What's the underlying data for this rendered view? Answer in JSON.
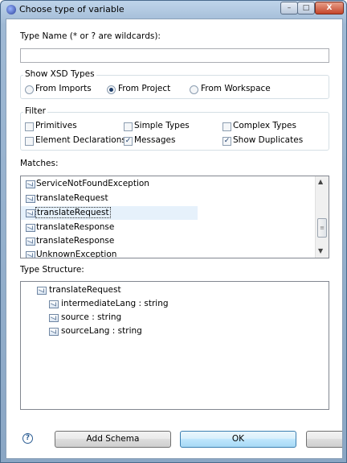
{
  "window": {
    "title": "Choose type of variable",
    "minimize": "–",
    "maximize": "□",
    "close": "X"
  },
  "type_name": {
    "label": "Type Name (* or ? are wildcards):",
    "value": ""
  },
  "xsd_group": {
    "title": "Show XSD Types",
    "options": [
      {
        "label": "From Imports",
        "selected": false
      },
      {
        "label": "From Project",
        "selected": true
      },
      {
        "label": "From Workspace",
        "selected": false
      }
    ]
  },
  "filter_group": {
    "title": "Filter",
    "items": [
      {
        "label": "Primitives",
        "checked": false
      },
      {
        "label": "Simple Types",
        "checked": false
      },
      {
        "label": "Complex Types",
        "checked": false
      },
      {
        "label": "Element Declarations",
        "checked": false
      },
      {
        "label": "Messages",
        "checked": true
      },
      {
        "label": "Show Duplicates",
        "checked": true
      }
    ]
  },
  "matches": {
    "label": "Matches:",
    "items": [
      {
        "label": "ServiceNotFoundException",
        "icon": "message-icon"
      },
      {
        "label": "translateRequest",
        "icon": "message-icon"
      },
      {
        "label": "translateRequest",
        "icon": "message-icon",
        "selected": true
      },
      {
        "label": "translateResponse",
        "icon": "message-icon"
      },
      {
        "label": "translateResponse",
        "icon": "message-icon"
      },
      {
        "label": "UnknownException",
        "icon": "message-icon"
      }
    ]
  },
  "type_structure": {
    "label": "Type Structure:",
    "root": "translateRequest",
    "children": [
      "intermediateLang : string",
      "source : string",
      "sourceLang : string"
    ]
  },
  "buttons": {
    "help": "?",
    "add_schema": "Add Schema",
    "ok": "OK",
    "cancel": ""
  }
}
